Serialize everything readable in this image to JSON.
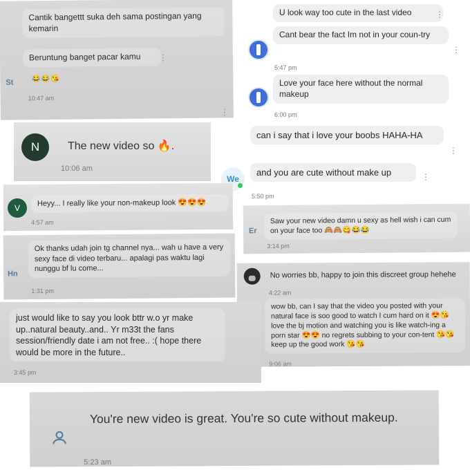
{
  "p1": {
    "msg1": "Cantik bangettt suka deh sama postingan yang kemarin",
    "msg2": "Beruntung banget pacar kamu",
    "initials": "St",
    "emojis": "😂😂😘",
    "time": "10:47 am"
  },
  "p2": {
    "msg1": "U look way too cute in the last video",
    "msg2": "Cant bear the fact Im not in your coun-try",
    "time1": "5:47 pm",
    "msg3": "Love your face here without the normal makeup",
    "time2": "6:00 pm"
  },
  "p3": {
    "avatar": "N",
    "msg": "The new video so 🔥.",
    "time": "10:06 am"
  },
  "p4": {
    "msg1": "can i say that i love your boobs HAHA-HA",
    "initials": "We",
    "msg2": "and you are cute without make up",
    "time": "5:50 pm"
  },
  "p5": {
    "avatar": "V",
    "msg": "Heyy... I really like your non-makeup look 😍😍😍",
    "time": "4:57 am"
  },
  "p6": {
    "initials": "Er",
    "msg": "Saw your new video damn u sexy as hell wish i can cum on your face too 🙈🙈😋😂😂",
    "time": "3:14 pm"
  },
  "p7": {
    "initials": "Hn",
    "msg": "Ok thanks udah join tg channel nya... wah u have a very sexy face di video terbaru... apalagi pas waktu lagi nunggu bf lu come...",
    "time": "1:31 pm"
  },
  "p8": {
    "msg1": "No worries bb, happy to join this discreet group hehehe",
    "time1": "4:22 am",
    "msg2": "wow bb, can I say that the video you posted with your natural face is soo good to watch I cum hard on it 😍😘 love the bj motion and watching you is like watch-ing a porn star 😍😍 no regrets subbing to your con-tent 😘😘 keep up the good work 😘😘",
    "time2": "9:06 am"
  },
  "p9": {
    "msg": "just would like to say you look bttr w.o yr make up..natural beauty..and.. Yr m33t the fans session/friendly date i am not free.. :( hope there would be more in the future..",
    "time": "3:45 pm"
  },
  "p10": {
    "msg": "You're new video is great. You're so cute without makeup.",
    "time": "5:23 am"
  },
  "colors": {
    "accent_green": "#1f5c3f",
    "avatar_dark": "#243a2f",
    "profile_blue": "#3d6fd6",
    "online_dot": "#34c759"
  },
  "icons": {
    "more": "more-vertical-icon",
    "fire": "fire-emoji-icon",
    "person": "person-outline-icon"
  }
}
